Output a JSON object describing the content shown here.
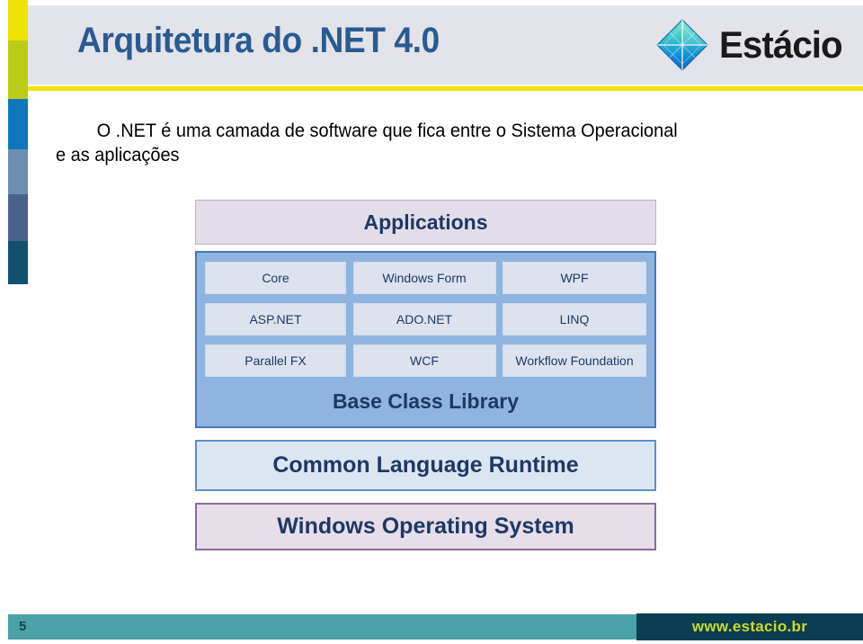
{
  "header": {
    "title": "Arquitetura do .NET 4.0",
    "logo": {
      "mark_name": "estacio-diamond-logo",
      "text": "Estácio",
      "color_top": "#5FD0C0",
      "color_bottom": "#0F72C8"
    },
    "background_color": "#E3E3EA",
    "rule_color": "#EDE500",
    "title_color": "#2A5A91"
  },
  "side_strip": {
    "colors": [
      "#EFE300",
      "#BBCC17",
      "#1077BC",
      "#6C8FAF",
      "#49628C",
      "#11506E"
    ]
  },
  "body": {
    "lead_line_1": "O .NET é uma camada de software que fica entre o Sistema Operacional",
    "lead_line_2": "e as aplicações"
  },
  "diagram": {
    "applications": {
      "label": "Applications",
      "bg": "#E2DDE8",
      "border": "#B8B2C4"
    },
    "base_class_library": {
      "title": "Base Class Library",
      "bg": "#8FB4E0",
      "border": "#4679B5",
      "rows": [
        [
          "Core",
          "Windows Form",
          "WPF"
        ],
        [
          "ASP.NET",
          "ADO.NET",
          "LINQ"
        ],
        [
          "Parallel FX",
          "WCF",
          "Workflow Foundation"
        ]
      ]
    },
    "common_language_runtime": {
      "label": "Common Language Runtime",
      "bg": "#DCE6F1",
      "border": "#5B8FC9"
    },
    "windows_operating_system": {
      "label": "Windows Operating System",
      "bg": "#E6DEE9",
      "border": "#8B6A9B"
    }
  },
  "footer": {
    "page_number": "5",
    "url": "www.estacio.br",
    "bar_color": "#4AA2A8",
    "panel_color": "#0B3D53",
    "url_color": "#CBDB2A"
  }
}
